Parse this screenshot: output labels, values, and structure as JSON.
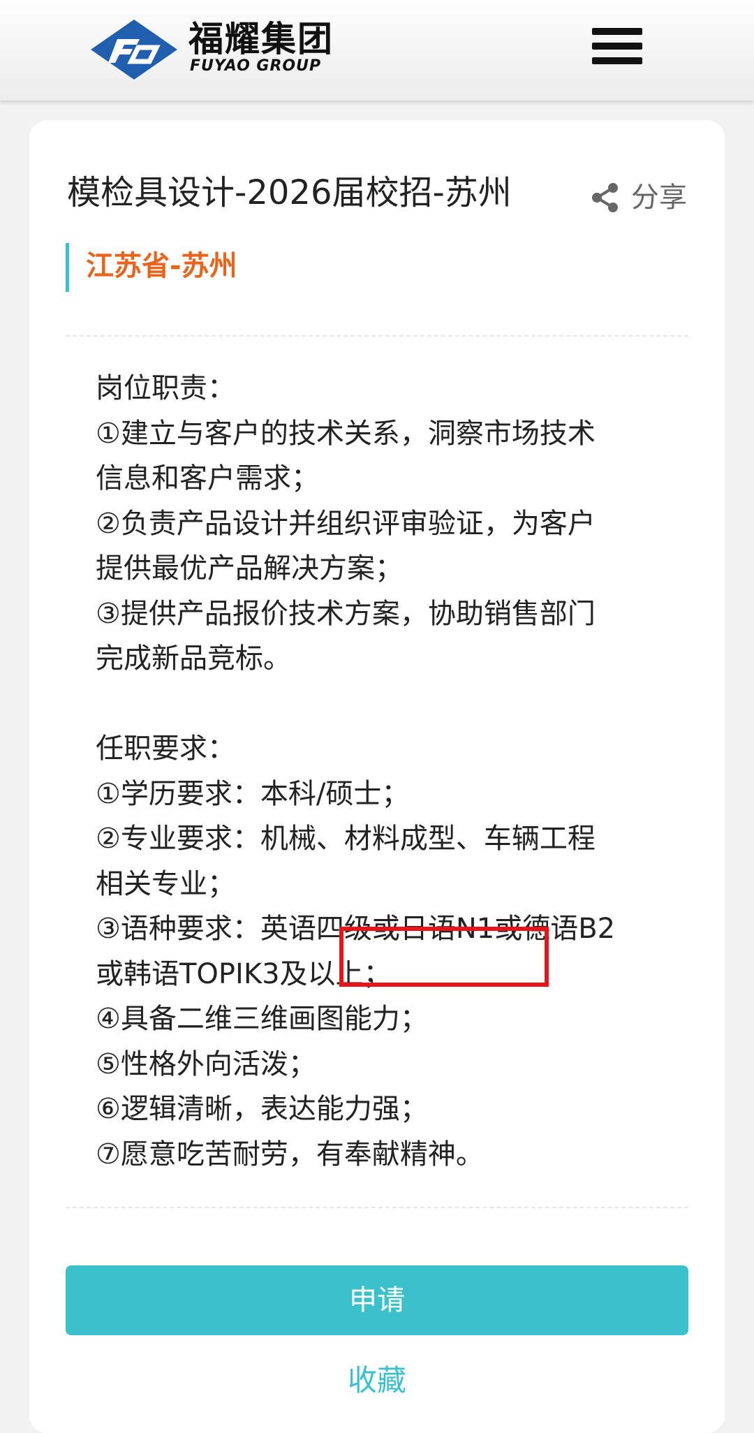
{
  "header": {
    "logo_cn": "福耀集团",
    "logo_en": "FUYAO GROUP",
    "menu_icon": "hamburger-menu-icon"
  },
  "job": {
    "title": "模检具设计-2026届校招-苏州",
    "share_label": "分享",
    "share_icon": "share-icon",
    "location": "江苏省-苏州"
  },
  "description": {
    "duties_heading": "岗位职责：",
    "duties": [
      "①建立与客户的技术关系，洞察市场技术",
      "信息和客户需求；",
      "②负责产品设计并组织评审验证，为客户",
      "提供最优产品解决方案；",
      "③提供产品报价技术方案，协助销售部门",
      "完成新品竞标。"
    ],
    "requirements_heading": "任职要求：",
    "requirements": [
      "①学历要求：本科/硕士；",
      "②专业要求：机械、材料成型、车辆工程",
      "相关专业；",
      "③语种要求：英语四级或日语N1或德语B2",
      "或韩语TOPIK3及以上；",
      "④具备二维三维画图能力；",
      "⑤性格外向活泼；",
      "⑥逻辑清晰，表达能力强；",
      "⑦愿意吃苦耐劳，有奉献精神。"
    ]
  },
  "actions": {
    "apply_label": "申请",
    "favorite_label": "收藏"
  },
  "colors": {
    "accent": "#3bc1ca",
    "location": "#e8641c",
    "highlight": "#e8141a",
    "logo_blue": "#1f5fae"
  }
}
